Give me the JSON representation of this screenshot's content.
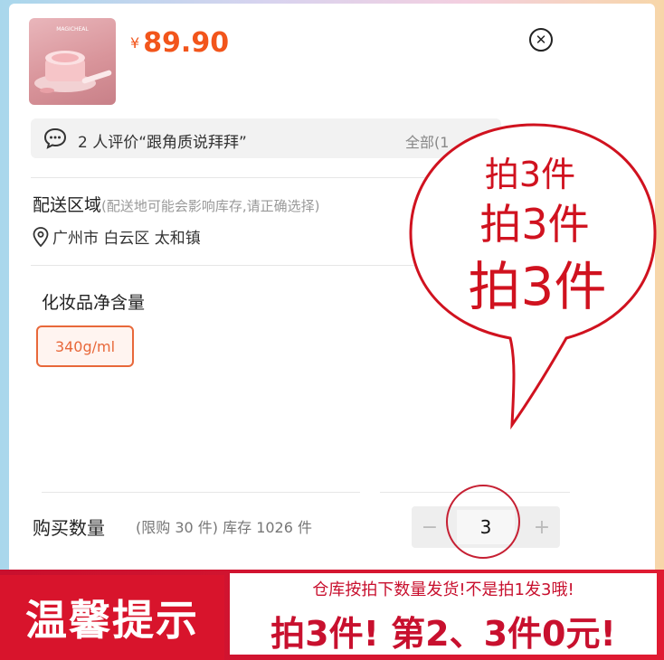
{
  "product": {
    "currency": "¥",
    "price": "89.90",
    "image_icon": "product-thumbnail"
  },
  "review": {
    "text": "2 人评价“跟角质说拜拜”",
    "all_label": "全部(1"
  },
  "delivery": {
    "title": "配送区域",
    "note": "(配送地可能会影响库存,请正确选择)",
    "address": "广州市 白云区 太和镇"
  },
  "spec": {
    "title": "化妆品净含量",
    "option": "340g/ml"
  },
  "quantity": {
    "title": "购买数量",
    "note": "(限购 30 件) 库存 1026 件",
    "value": "3",
    "minus": "−",
    "plus": "+"
  },
  "bubble": {
    "line1": "拍3件",
    "line2": "拍3件",
    "line3": "拍3件"
  },
  "footer": {
    "badge": "温馨提示",
    "line1": "仓库按拍下数量发货!不是拍1发3哦!",
    "line2": "拍3件! 第2、3件0元!"
  },
  "colors": {
    "price": "#f2551b",
    "accent_red": "#d0121f",
    "chip_border": "#e8683a"
  }
}
